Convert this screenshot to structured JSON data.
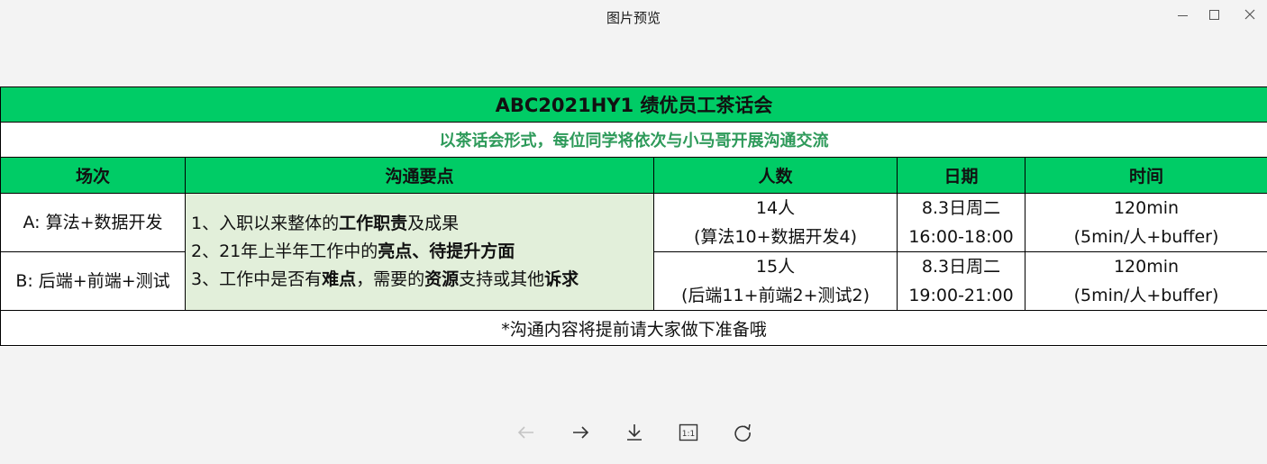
{
  "window": {
    "title": "图片预览"
  },
  "table": {
    "title": "ABC2021HY1 绩优员工茶话会",
    "subtitle": "以茶话会形式，每位同学将依次与小马哥开展沟通交流",
    "headers": [
      "场次",
      "沟通要点",
      "人数",
      "日期",
      "时间"
    ],
    "rows": [
      {
        "session": "A: 算法+数据开发",
        "people_count": "14人",
        "people_detail": "(算法10+数据开发4)",
        "date": "8.3日周二",
        "time_range": "16:00-18:00",
        "duration": "120min",
        "duration_detail": "(5min/人+buffer)"
      },
      {
        "session": "B: 后端+前端+测试",
        "people_count": "15人",
        "people_detail": "(后端11+前端2+测试2)",
        "date": "8.3日周二",
        "time_range": "19:00-21:00",
        "duration": "120min",
        "duration_detail": "(5min/人+buffer)"
      }
    ],
    "points": [
      {
        "prefix": "1、入职以来整体的",
        "bold": "工作职责",
        "suffix": "及成果"
      },
      {
        "prefix": "2、21年上半年工作中的",
        "bold": "亮点、待提升方面",
        "suffix": ""
      },
      {
        "prefix": "3、工作中是否有",
        "bold": "难点",
        "mid": "，需要的",
        "bold2": "资源",
        "mid2": "支持或其他",
        "bold3": "诉求"
      }
    ],
    "note": "*沟通内容将提前请大家做下准备哦"
  },
  "toolbar": {
    "icons": [
      "arrow-left-icon",
      "arrow-right-icon",
      "download-icon",
      "original-size-icon",
      "rotate-icon"
    ],
    "original_size_label": "1:1"
  },
  "colors": {
    "header_green": "#00cc66",
    "subtitle_text": "#2e9a5a",
    "points_bg": "#e2efda"
  }
}
